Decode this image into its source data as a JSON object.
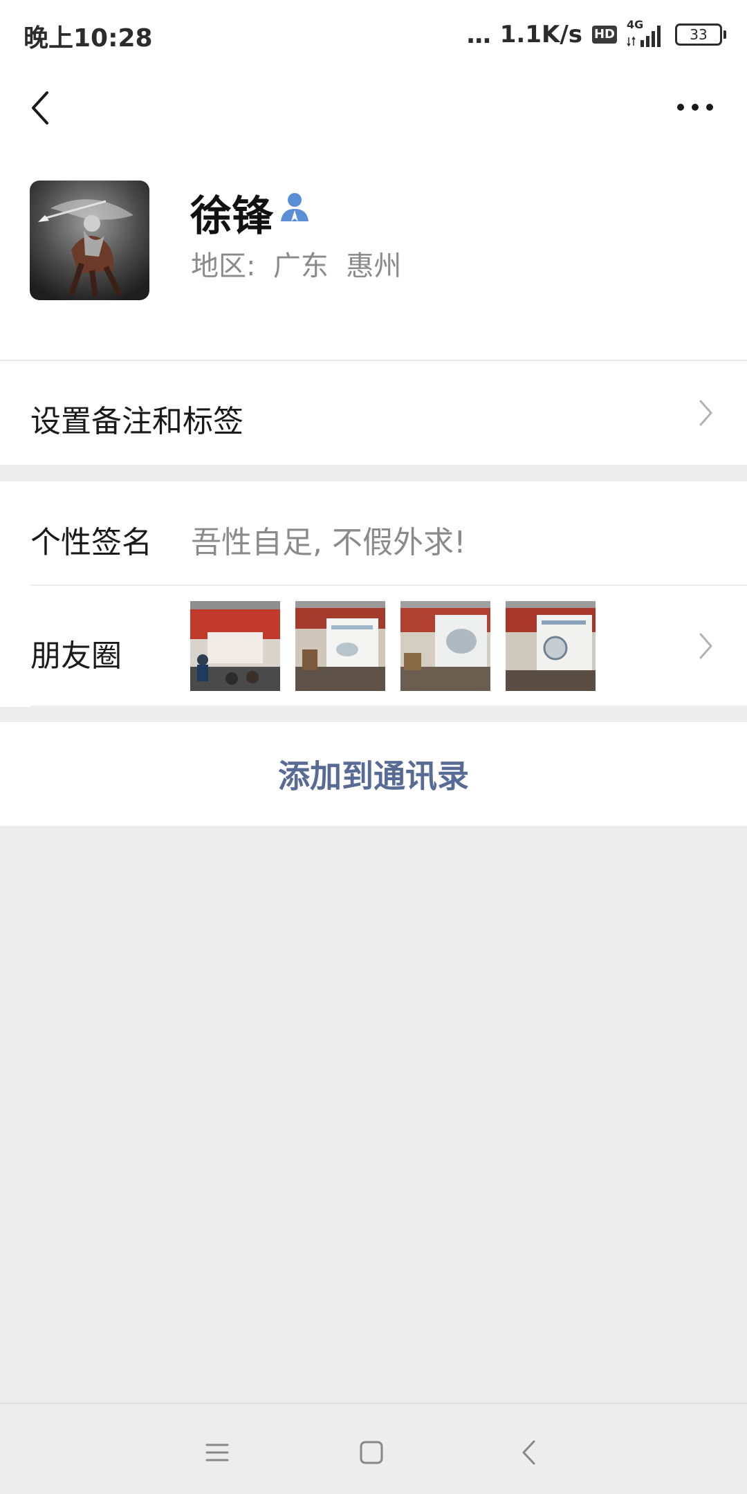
{
  "status_bar": {
    "time": "晚上10:28",
    "dots": "...",
    "speed": "1.1K/s",
    "hd": "HD",
    "network": "4G",
    "battery": "33"
  },
  "profile": {
    "name": "徐锋",
    "region": "地区:  广东  惠州"
  },
  "remark": {
    "label": "设置备注和标签"
  },
  "signature": {
    "label": "个性签名",
    "value": "吾性自足, 不假外求!"
  },
  "moments": {
    "label": "朋友圈",
    "thumbnail_count": 4
  },
  "actions": {
    "add_contact": "添加到通讯录"
  },
  "colors": {
    "link": "#576b95",
    "background": "#ededed",
    "verify_icon": "#5a8fd8"
  }
}
